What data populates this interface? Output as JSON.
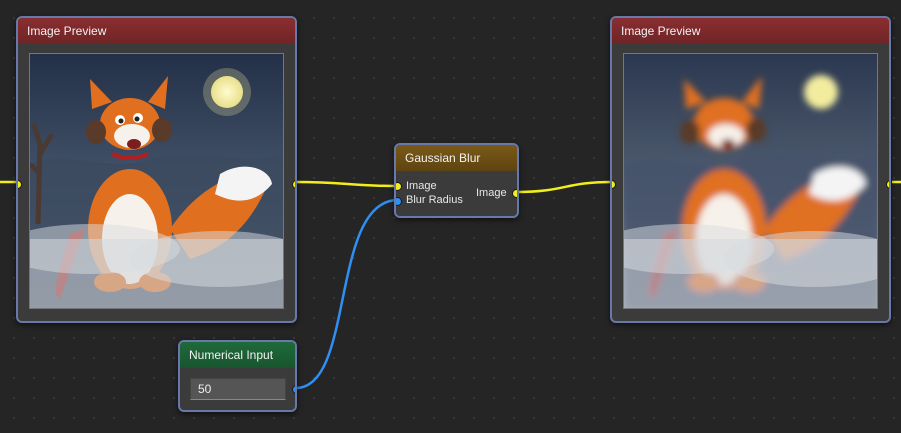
{
  "nodes": {
    "preview_left": {
      "title": "Image Preview"
    },
    "preview_right": {
      "title": "Image Preview"
    },
    "blur": {
      "title": "Gaussian Blur",
      "inputs": [
        "Image",
        "Blur Radius"
      ],
      "output": "Image"
    },
    "numeric": {
      "title": "Numerical Input",
      "value": "50"
    }
  },
  "colors": {
    "canvas": "#252525",
    "node_border": "#6878a8",
    "image_wire": "#f2ee1b",
    "number_wire": "#2f8ff2",
    "header_image_preview": "#8a2e31",
    "header_gaussian_blur": "#7a5a18",
    "header_numerical_input": "#1f6a3a"
  }
}
